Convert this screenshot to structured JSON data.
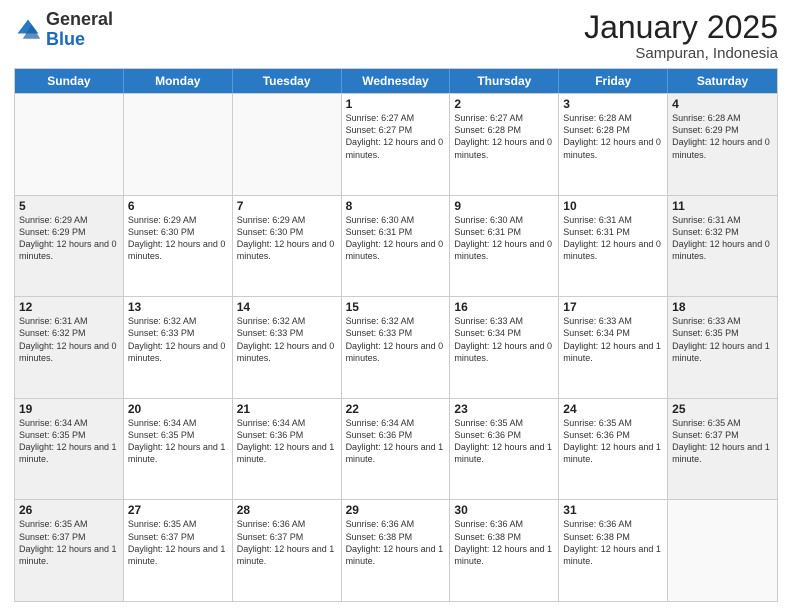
{
  "logo": {
    "general": "General",
    "blue": "Blue"
  },
  "title": "January 2025",
  "subtitle": "Sampuran, Indonesia",
  "days": [
    "Sunday",
    "Monday",
    "Tuesday",
    "Wednesday",
    "Thursday",
    "Friday",
    "Saturday"
  ],
  "rows": [
    [
      {
        "day": "",
        "text": "",
        "empty": true
      },
      {
        "day": "",
        "text": "",
        "empty": true
      },
      {
        "day": "",
        "text": "",
        "empty": true
      },
      {
        "day": "1",
        "text": "Sunrise: 6:27 AM\nSunset: 6:27 PM\nDaylight: 12 hours and 0 minutes."
      },
      {
        "day": "2",
        "text": "Sunrise: 6:27 AM\nSunset: 6:28 PM\nDaylight: 12 hours and 0 minutes."
      },
      {
        "day": "3",
        "text": "Sunrise: 6:28 AM\nSunset: 6:28 PM\nDaylight: 12 hours and 0 minutes."
      },
      {
        "day": "4",
        "text": "Sunrise: 6:28 AM\nSunset: 6:29 PM\nDaylight: 12 hours and 0 minutes.",
        "shaded": true
      }
    ],
    [
      {
        "day": "5",
        "text": "Sunrise: 6:29 AM\nSunset: 6:29 PM\nDaylight: 12 hours and 0 minutes.",
        "shaded": true
      },
      {
        "day": "6",
        "text": "Sunrise: 6:29 AM\nSunset: 6:30 PM\nDaylight: 12 hours and 0 minutes."
      },
      {
        "day": "7",
        "text": "Sunrise: 6:29 AM\nSunset: 6:30 PM\nDaylight: 12 hours and 0 minutes."
      },
      {
        "day": "8",
        "text": "Sunrise: 6:30 AM\nSunset: 6:31 PM\nDaylight: 12 hours and 0 minutes."
      },
      {
        "day": "9",
        "text": "Sunrise: 6:30 AM\nSunset: 6:31 PM\nDaylight: 12 hours and 0 minutes."
      },
      {
        "day": "10",
        "text": "Sunrise: 6:31 AM\nSunset: 6:31 PM\nDaylight: 12 hours and 0 minutes."
      },
      {
        "day": "11",
        "text": "Sunrise: 6:31 AM\nSunset: 6:32 PM\nDaylight: 12 hours and 0 minutes.",
        "shaded": true
      }
    ],
    [
      {
        "day": "12",
        "text": "Sunrise: 6:31 AM\nSunset: 6:32 PM\nDaylight: 12 hours and 0 minutes.",
        "shaded": true
      },
      {
        "day": "13",
        "text": "Sunrise: 6:32 AM\nSunset: 6:33 PM\nDaylight: 12 hours and 0 minutes."
      },
      {
        "day": "14",
        "text": "Sunrise: 6:32 AM\nSunset: 6:33 PM\nDaylight: 12 hours and 0 minutes."
      },
      {
        "day": "15",
        "text": "Sunrise: 6:32 AM\nSunset: 6:33 PM\nDaylight: 12 hours and 0 minutes."
      },
      {
        "day": "16",
        "text": "Sunrise: 6:33 AM\nSunset: 6:34 PM\nDaylight: 12 hours and 0 minutes."
      },
      {
        "day": "17",
        "text": "Sunrise: 6:33 AM\nSunset: 6:34 PM\nDaylight: 12 hours and 1 minute."
      },
      {
        "day": "18",
        "text": "Sunrise: 6:33 AM\nSunset: 6:35 PM\nDaylight: 12 hours and 1 minute.",
        "shaded": true
      }
    ],
    [
      {
        "day": "19",
        "text": "Sunrise: 6:34 AM\nSunset: 6:35 PM\nDaylight: 12 hours and 1 minute.",
        "shaded": true
      },
      {
        "day": "20",
        "text": "Sunrise: 6:34 AM\nSunset: 6:35 PM\nDaylight: 12 hours and 1 minute."
      },
      {
        "day": "21",
        "text": "Sunrise: 6:34 AM\nSunset: 6:36 PM\nDaylight: 12 hours and 1 minute."
      },
      {
        "day": "22",
        "text": "Sunrise: 6:34 AM\nSunset: 6:36 PM\nDaylight: 12 hours and 1 minute."
      },
      {
        "day": "23",
        "text": "Sunrise: 6:35 AM\nSunset: 6:36 PM\nDaylight: 12 hours and 1 minute."
      },
      {
        "day": "24",
        "text": "Sunrise: 6:35 AM\nSunset: 6:36 PM\nDaylight: 12 hours and 1 minute."
      },
      {
        "day": "25",
        "text": "Sunrise: 6:35 AM\nSunset: 6:37 PM\nDaylight: 12 hours and 1 minute.",
        "shaded": true
      }
    ],
    [
      {
        "day": "26",
        "text": "Sunrise: 6:35 AM\nSunset: 6:37 PM\nDaylight: 12 hours and 1 minute.",
        "shaded": true
      },
      {
        "day": "27",
        "text": "Sunrise: 6:35 AM\nSunset: 6:37 PM\nDaylight: 12 hours and 1 minute."
      },
      {
        "day": "28",
        "text": "Sunrise: 6:36 AM\nSunset: 6:37 PM\nDaylight: 12 hours and 1 minute."
      },
      {
        "day": "29",
        "text": "Sunrise: 6:36 AM\nSunset: 6:38 PM\nDaylight: 12 hours and 1 minute."
      },
      {
        "day": "30",
        "text": "Sunrise: 6:36 AM\nSunset: 6:38 PM\nDaylight: 12 hours and 1 minute."
      },
      {
        "day": "31",
        "text": "Sunrise: 6:36 AM\nSunset: 6:38 PM\nDaylight: 12 hours and 1 minute."
      },
      {
        "day": "",
        "text": "",
        "empty": true
      }
    ]
  ]
}
